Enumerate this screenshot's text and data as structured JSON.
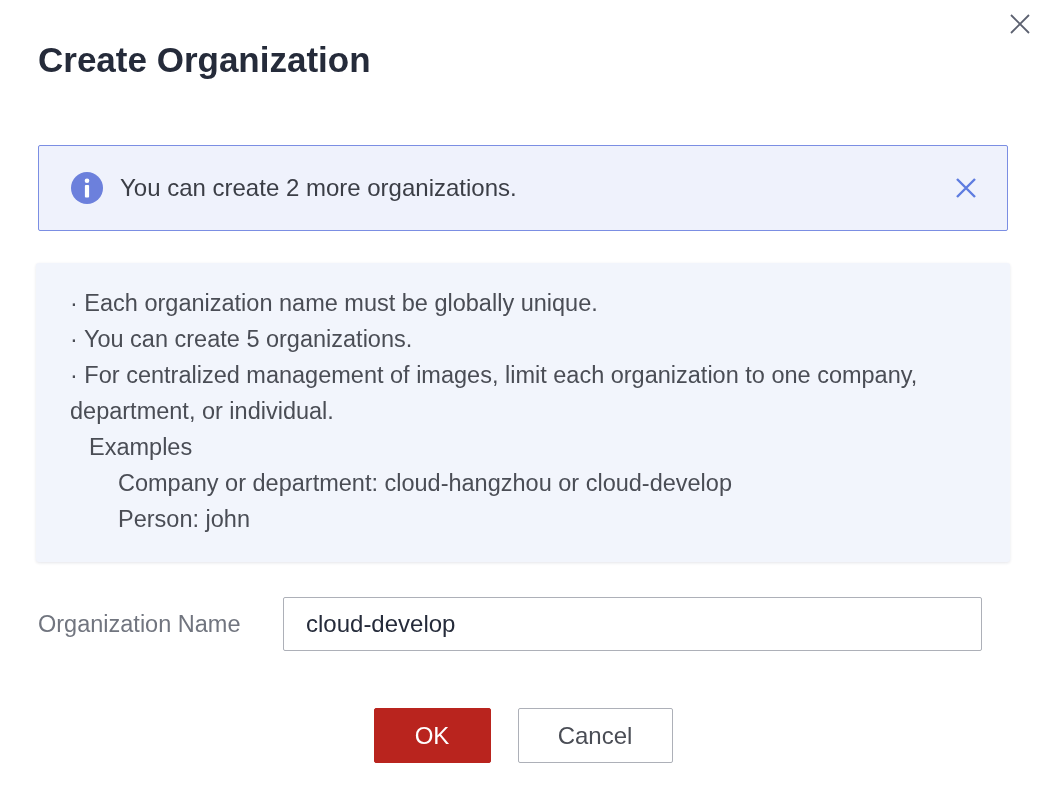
{
  "dialog": {
    "title": "Create Organization",
    "closable": true
  },
  "alert": {
    "kind": "info",
    "text": "You can create 2 more organizations.",
    "dismissible": true
  },
  "notes": {
    "items": [
      "· Each organization name must be globally unique.",
      "· You can create 5 organizations.",
      "· For centralized management of images, limit each organization to one company, department, or individual."
    ],
    "examples": {
      "heading": "Examples",
      "items": [
        "Company or department: cloud-hangzhou or cloud-develop",
        "Person: john"
      ]
    }
  },
  "form": {
    "fields": [
      {
        "label": "Organization Name",
        "value": "cloud-develop"
      }
    ]
  },
  "buttons": [
    {
      "label": "OK",
      "kind": "primary"
    },
    {
      "label": "Cancel",
      "kind": "secondary"
    }
  ]
}
